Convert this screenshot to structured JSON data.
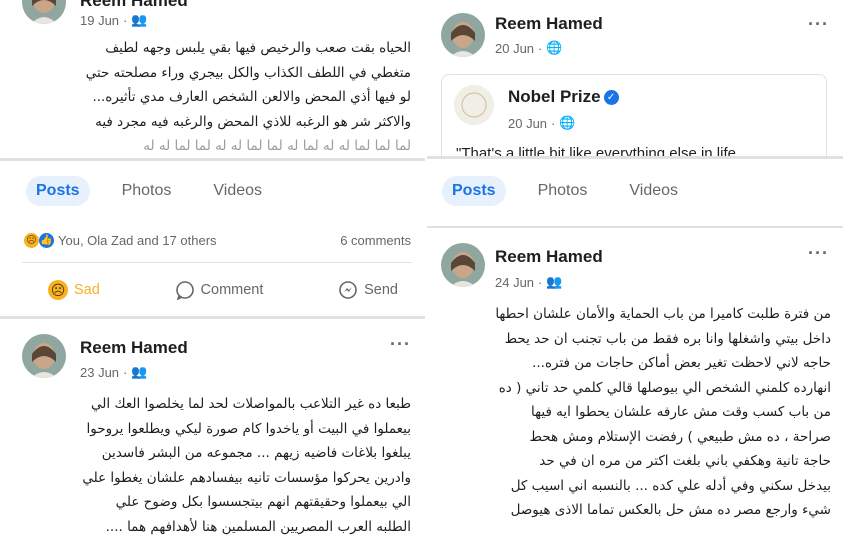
{
  "colors": {
    "accent": "#1b74e4",
    "muted": "#65676b",
    "sad": "#f7b125"
  },
  "left_top_post": {
    "author": "Reem Hamed",
    "date": "19 Jun",
    "privacy_icon": "friends-icon",
    "lines": [
      "الحياه بقت صعب والرخيص فيها بقي يلبس وجهه لطيف",
      "متغطي في اللطف الكذاب والكل بيجري وراء مصلحته حتي",
      "لو فيها أذي المحض والالعن الشخص العارف مدي تأثيره...",
      "والاكثر شر هو الرغبه للاذي المحض  والرغبه فيه مجرد فيه",
      "لما لما لما له له لما له لما لما له له لما لما له له"
    ]
  },
  "right_top_post": {
    "author": "Reem Hamed",
    "date": "20 Jun",
    "privacy_icon": "globe-icon",
    "shared": {
      "author": "Nobel Prize",
      "date": "20 Jun",
      "text": "\"That's a little bit like everything else in life"
    }
  },
  "tabs_left": [
    "Posts",
    "Photos",
    "Videos"
  ],
  "tabs_right": [
    "Posts",
    "Photos",
    "Videos"
  ],
  "engagement": {
    "reactors": "You, Ola Zad and 17 others",
    "comments": "6 comments",
    "sad_label": "Sad",
    "comment_label": "Comment",
    "send_label": "Send"
  },
  "left_bottom_post": {
    "author": "Reem Hamed",
    "date": "23 Jun",
    "privacy_icon": "friends-icon",
    "lines": [
      "طبعا ده غير التلاعب بالمواصلات لحد لما يخلصوا العك الي",
      "بيعملوا في البيت أو ياخدوا كام صورة ليكي ويطلعوا يروحوا",
      "يبلغوا بلاغات فاضيه زيهم  ... مجموعه من البشر فاسدين",
      "وادرين يحركوا مؤسسات تانيه بيفسادهم علشان يغطوا علي",
      "الي بيعملوا وحقيقتهم انهم بيتجسسوا بكل وضوح علي",
      "الطلبه العرب المصريين المسلمين هنا لأهدافهم هما ...."
    ]
  },
  "right_bottom_post": {
    "author": "Reem Hamed",
    "date": "24 Jun",
    "privacy_icon": "friends-icon",
    "lines": [
      "من فترة طلبت كاميرا من باب الحماية والأمان علشان احطها",
      "داخل بيتي واشغلها وانا بره فقط من باب تجنب ان حد يحط",
      "حاجه لاني لاحظت تغير بعض أماكن حاجات   من فتره...",
      "انهارده كلمني الشخص الي بيوصلها قالي كلمي حد تاني ( ده",
      "من باب كسب وقت مش عارفه علشان يحطوا ايه فيها",
      "صراحة ، ده مش طبيعي ) رفضت الإستلام ومش هحط",
      "حاجة تانية وهكفي باني بلغت اكتر من مره ان في حد",
      "بيدخل سكني وفي أدله علي كده ... بالنسبه اني اسيب كل",
      "شيء وارجع مصر ده مش حل  بالعكس تماما الاذى هيوصل"
    ]
  }
}
